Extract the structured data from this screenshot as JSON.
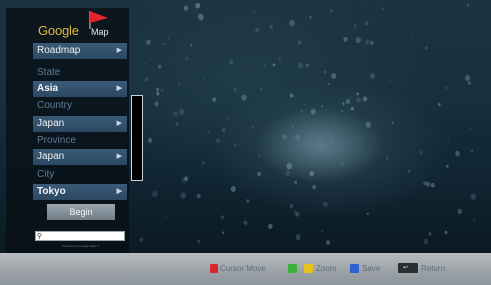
{
  "logo": {
    "brand": "Google",
    "product": "Map"
  },
  "map_type": "Roadmap",
  "state": {
    "label": "State",
    "value": "Asia"
  },
  "country": {
    "label": "Country",
    "value": "Japan"
  },
  "province": {
    "label": "Province",
    "value": "Japan"
  },
  "city": {
    "label": "City",
    "value": "Tokyo"
  },
  "begin_label": "Begin",
  "powered_text": "Powered by Google Maps ©",
  "footer": {
    "cursor_move": "Cursor Move",
    "zoom": "Zoom",
    "save": "Save",
    "return": "Return"
  },
  "colors": {
    "red": "#d8262e",
    "green": "#3bb23c",
    "yellow": "#e6c419",
    "blue": "#2f5fd1",
    "brand": "#e3b640",
    "flag": "#e0242f"
  },
  "icons": {
    "flag": "flag-icon",
    "chevron": "chevron-right-icon",
    "search": "search-icon",
    "return_key": "return-key-icon"
  }
}
